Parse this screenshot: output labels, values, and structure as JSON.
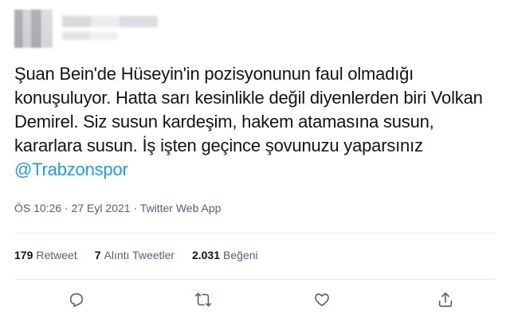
{
  "tweet": {
    "text_main": "Şuan Bein'de Hüseyin'in pozisyonunun faul olmadığı konuşuluyor. Hatta sarı kesinlikle değil diyenlerden biri Volkan Demirel. Siz susun kardeşim, hakem atamasına susun, kararlara susun. İş işten geçince şovunuzu yaparsınız ",
    "mention": "@Trabzonspor",
    "meta": "ÖS 10:26 · 27 Eyl 2021 · Twitter Web App"
  },
  "stats": {
    "retweets_count": "179",
    "retweets_label": "Retweet",
    "quotes_count": "7",
    "quotes_label": "Alıntı Tweetler",
    "likes_count": "2.031",
    "likes_label": "Beğeni"
  },
  "actions": {
    "reply_icon": "reply-icon",
    "retweet_icon": "retweet-icon",
    "like_icon": "heart-icon",
    "share_icon": "share-icon"
  },
  "colors": {
    "accent": "#1d9bf0",
    "text": "#0f1419",
    "muted": "#536471",
    "divider": "#e6ecf0"
  }
}
